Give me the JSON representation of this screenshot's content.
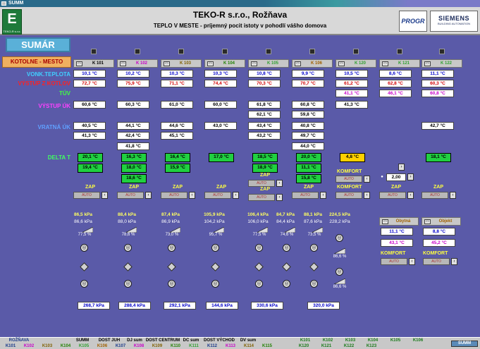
{
  "window": {
    "title": "SUMM"
  },
  "header": {
    "logo_letter": "E",
    "logo_sub": "TEKO-R s.r.o.",
    "title": "TEKO-R s.r.o., Rožňava",
    "subtitle": "TEPLO V MESTE - príjemný pocit istoty v pohodlí vášho domova",
    "logo_progr": "PROGR",
    "siemens_name": "SIEMENS",
    "siemens_sub": "BUILDING AUTOMATION"
  },
  "left": {
    "sumar": "SUMÁR",
    "kotolne": "KOTOLNE - MESTO",
    "rows": {
      "vonk": "VONK.TEPLOTA",
      "vystup_kotlov": "VÝSTUP Z KOTLOV",
      "tuv": "TÚV",
      "vystup_uk": "VÝSTUP ÚK",
      "vratna_uk": "VRATNÁ ÚK",
      "delta_t": "DELTA T"
    }
  },
  "columns": [
    {
      "name": "K 101"
    },
    {
      "name": "K 102"
    },
    {
      "name": "K 103"
    },
    {
      "name": "K 104"
    },
    {
      "name": "K 105"
    },
    {
      "name": "K 106"
    },
    {
      "name": "K 120"
    },
    {
      "name": "K 121"
    },
    {
      "name": "K 122"
    }
  ],
  "values": {
    "vonk": [
      "10,1 °C",
      "10,2 °C",
      "10,3 °C",
      "10,3 °C",
      "10,8 °C",
      "9,9 °C",
      "10,5 °C",
      "8,6 °C",
      "11,1 °C"
    ],
    "vystup_kotlov": [
      "72,7 °C",
      "75,9 °C",
      "71,1 °C",
      "74,4 °C",
      "70,3 °C",
      "70,7 °C",
      "61,2 °C",
      "62,8 °C",
      "60,3 °C"
    ],
    "tuv": [
      "41,1 °C",
      "46,1 °C",
      "60,8 °C"
    ],
    "vystup_uk_a": [
      "60,6 °C",
      "60,3 °C",
      "61,0 °C",
      "60,0 °C",
      "61,8 °C",
      "60,8 °C",
      "41,3 °C"
    ],
    "vystup_uk_b": [
      "62,1 °C",
      "59,8 °C"
    ],
    "vratna_a": [
      "40,5 °C",
      "44,1 °C",
      "44,6 °C",
      "43,0 °C",
      "43,4 °C",
      "40,8 °C",
      "42,7 °C"
    ],
    "vratna_b": [
      "41,3 °C",
      "42,4 °C",
      "45,1 °C",
      "43,2 °C",
      "49,7 °C"
    ],
    "vratna_c": [
      "41,8 °C",
      "44,0 °C"
    ],
    "delta_a": [
      "20,1 °C",
      "16,3 °C",
      "16,4 °C",
      "17,0 °C",
      "18,5 °C",
      "20,0 °C",
      "4,8 °C",
      "18,1 °C"
    ],
    "delta_b": [
      "19,4 °C",
      "18,0 °C",
      "15,9 °C",
      "18,9 °C",
      "11,1 °C"
    ],
    "delta_c": [
      "18,6 °C",
      "15,8 °C"
    ]
  },
  "controls": {
    "zap": "ZAP",
    "auto": "AUTO",
    "komfort": "KOMFORT",
    "setpoint": "2,00"
  },
  "pressure": {
    "supply": [
      "86,5 kPa",
      "88,4 kPa",
      "87,4 kPa",
      "105,9 kPa",
      "106,4 kPa",
      "84,7 kPa",
      "88,1 kPa",
      "224,5 kPa"
    ],
    "return": [
      "86,6 kPa",
      "88,0 kPa",
      "86,9 kPa",
      "104,2 kPa",
      "106,0 kPa",
      "84,4 kPa",
      "87,6 kPa",
      "228,2 kPa"
    ],
    "valve": [
      "77,5 %",
      "78,6 %",
      "73,0 %",
      "95,7 %",
      "77,5 %",
      "74,6 %",
      "73,5 %"
    ],
    "extra_valve": [
      "86,6 %",
      "86,6 %"
    ],
    "bottom": [
      "268,7 kPa",
      "288,4 kPa",
      "292,1 kPa",
      "144,6 kPa",
      "330,6 kPa",
      "320,0 kPa"
    ]
  },
  "right_panel": {
    "hdr1": "Obytná",
    "hdr2": "Objekt",
    "v1a": "11,1 °C",
    "v1b": "43,1 °C",
    "v2a": "8,8 °C",
    "v2b": "45,2 °C",
    "komfort": "KOMFORT"
  },
  "statusbar": {
    "top": [
      "ROŽŇAVA",
      "SUMM",
      "DOST JUH",
      "DJ sum",
      "DOST CENTRUM",
      "DC sum",
      "DOST VÝCHOD",
      "DV sum",
      "K101",
      "K102",
      "K103",
      "K104",
      "K105",
      "K106"
    ],
    "bottom": [
      "K101",
      "K102",
      "K103",
      "K104",
      "K105",
      "K106",
      "K107",
      "K108",
      "K109",
      "K110",
      "K111",
      "K112",
      "K113",
      "K114",
      "K115",
      "K120",
      "K121",
      "K122",
      "K123"
    ],
    "right_label": "SUMM"
  }
}
